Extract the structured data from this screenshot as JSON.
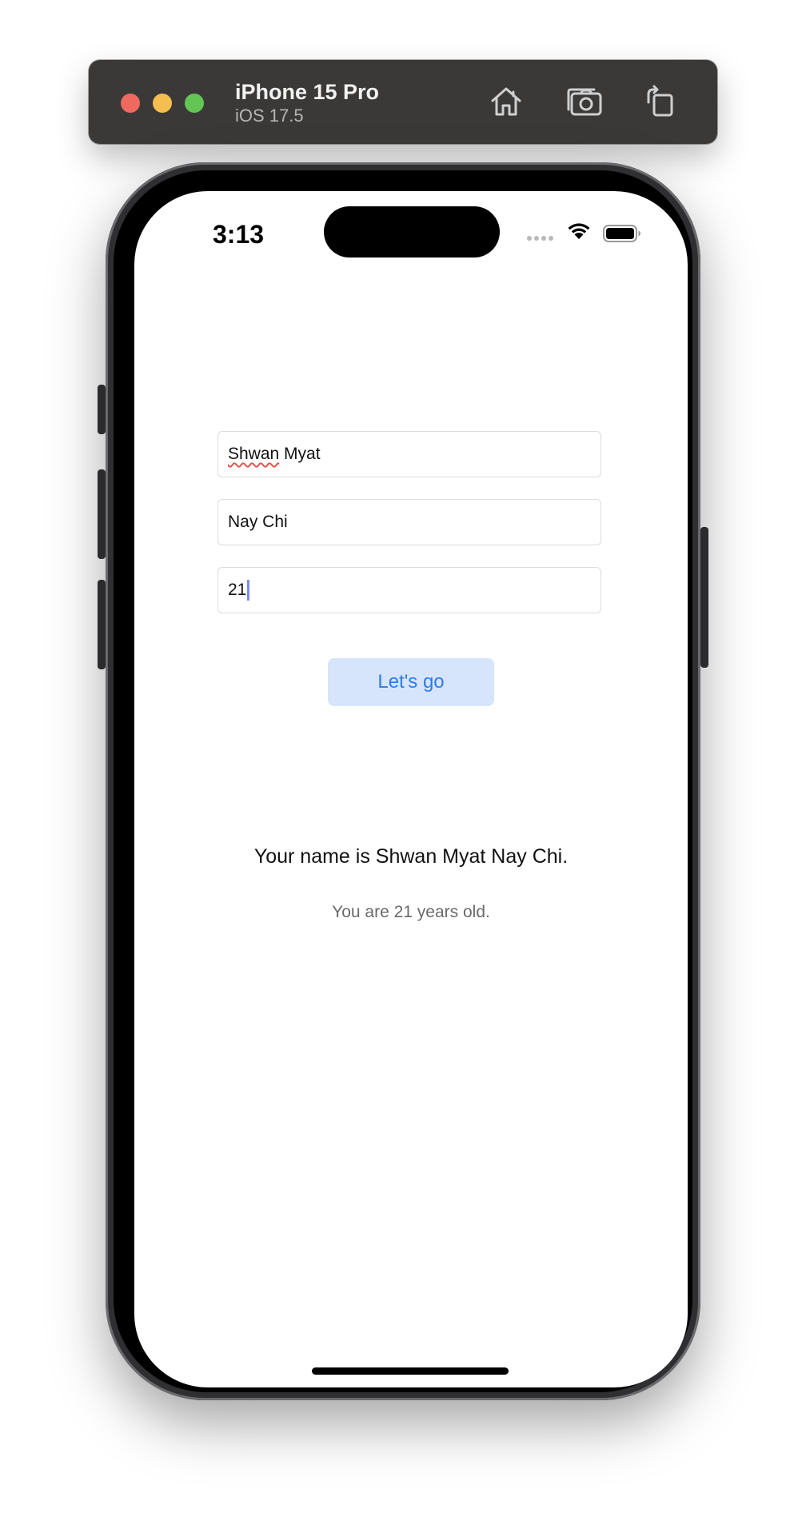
{
  "simulator": {
    "device_name": "iPhone 15 Pro",
    "os_version": "iOS 17.5",
    "buttons": {
      "home": "home-icon",
      "screenshot": "camera-icon",
      "rotate": "rotate-icon"
    }
  },
  "status_bar": {
    "time": "3:13"
  },
  "form": {
    "first_name_value": "Shwan",
    "first_name_rest": " Myat",
    "last_name_value": "Nay Chi",
    "age_value": "21",
    "submit_label": "Let's go"
  },
  "result": {
    "name_text": "Your name is Shwan Myat Nay Chi.",
    "age_text": "You are 21 years old."
  },
  "colors": {
    "accent": "#2f7be6",
    "button_bg": "#d6e5fb",
    "spellcheck": "#e0564f"
  }
}
